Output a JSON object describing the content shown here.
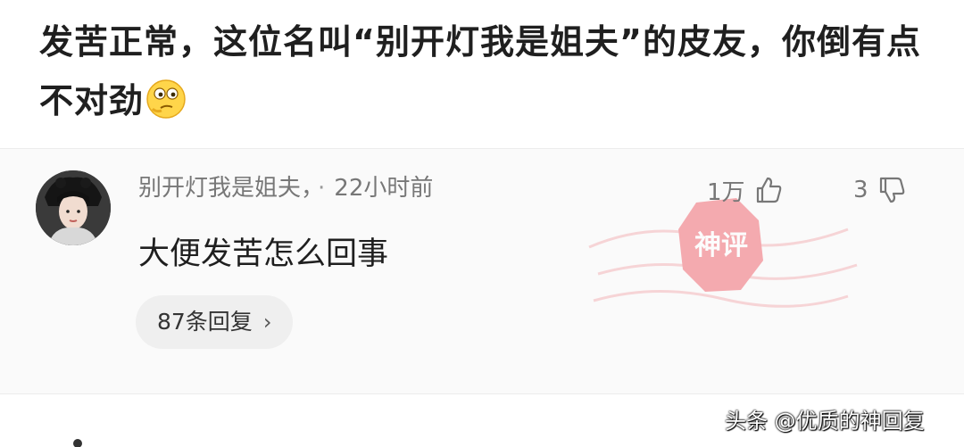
{
  "post": {
    "headline": "发苦正常，这位名叫“别开灯我是姐夫”的皮友，你倒有点不对劲",
    "emoji_icon": "thinking-face-icon"
  },
  "comment": {
    "username": "别开灯我是姐夫，",
    "time_separator": "·",
    "time": "22小时前",
    "text": "大便发苦怎么回事",
    "likes": "1万",
    "dislikes": "3",
    "replies_label": "87条回复",
    "replies_chevron": "›"
  },
  "stamp": {
    "label": "神评"
  },
  "watermark": {
    "text": "头条 @优质的神回复"
  },
  "colors": {
    "stamp_red": "#f06a73",
    "meta_gray": "#777777"
  }
}
